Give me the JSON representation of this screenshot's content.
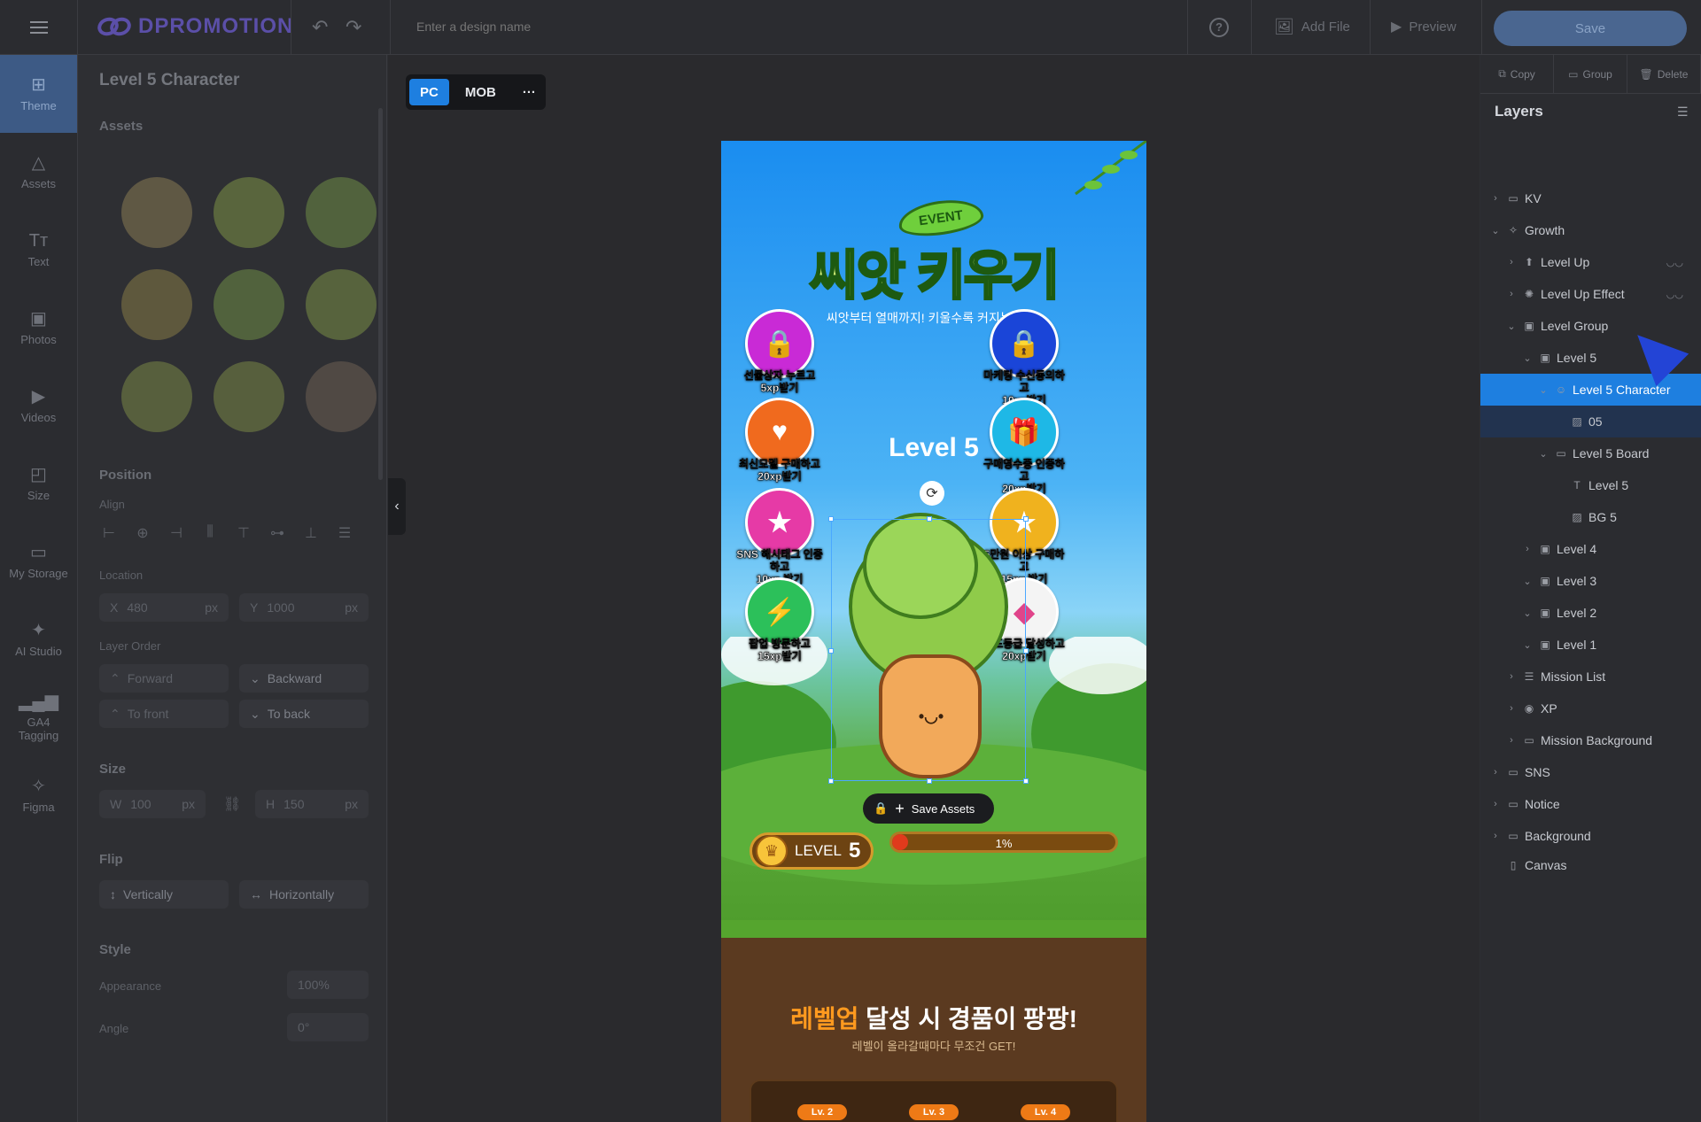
{
  "app": {
    "logo": "DPROMOTION",
    "design_name_placeholder": "Enter a design name",
    "help": "?",
    "add_file": "Add File",
    "preview": "Preview",
    "save": "Save"
  },
  "nav": [
    {
      "label": "Theme",
      "icon": "theme-icon",
      "glyph": "⊞"
    },
    {
      "label": "Assets",
      "icon": "shapes-icon",
      "glyph": "△"
    },
    {
      "label": "Text",
      "icon": "text-icon",
      "glyph": "Tт"
    },
    {
      "label": "Photos",
      "icon": "photo-icon",
      "glyph": "▣"
    },
    {
      "label": "Videos",
      "icon": "video-icon",
      "glyph": "▶"
    },
    {
      "label": "Size",
      "icon": "resize-icon",
      "glyph": "◰"
    },
    {
      "label": "My Storage",
      "icon": "folder-icon",
      "glyph": "▭"
    },
    {
      "label": "AI Studio",
      "icon": "magic-wand-icon",
      "glyph": "✦"
    },
    {
      "label": "GA4\nTagging",
      "icon": "analytics-icon",
      "glyph": "▂▄▆"
    },
    {
      "label": "Figma",
      "icon": "figma-icon",
      "glyph": "✧"
    }
  ],
  "left_panel": {
    "title": "Level 5 Character",
    "assets_label": "Assets",
    "position": "Position",
    "align": "Align",
    "location": "Location",
    "x_label": "X",
    "x_value": "480",
    "y_label": "Y",
    "y_value": "1000",
    "unit": "px",
    "layer_order": "Layer Order",
    "forward": "Forward",
    "backward": "Backward",
    "to_front": "To front",
    "to_back": "To back",
    "size": "Size",
    "w_label": "W",
    "w_value": "100",
    "h_label": "H",
    "h_value": "150",
    "flip": "Flip",
    "vertically": "Vertically",
    "horizontally": "Horizontally",
    "style": "Style",
    "appearance": "Appearance",
    "appearance_value": "100%",
    "angle": "Angle",
    "angle_value": "0°"
  },
  "canvas": {
    "pc": "PC",
    "mob": "MOB",
    "more": "···",
    "event": "EVENT",
    "headline": "씨앗 키우기",
    "subline": "씨앗부터 열매까지! 키울수록 커지는 혜택!",
    "level_title": "Level 5",
    "missions": [
      {
        "line1": "선물상자 누르고",
        "line2": "5xp받기",
        "color": "#c92ad6",
        "glyph": "🔒",
        "icon": "treasure-chest-icon"
      },
      {
        "line1": "마케팅 수신동의하고",
        "line2": "10xp받기",
        "color": "#1a45d8",
        "glyph": "🔒",
        "icon": "padlock-icon"
      },
      {
        "line1": "최신모델 구매하고",
        "line2": "20xp받기",
        "color": "#f06a1e",
        "glyph": "♥",
        "icon": "shopping-bag-icon"
      },
      {
        "line1": "구매영수증 인증하고",
        "line2": "20xp받기",
        "color": "#1eb8e6",
        "glyph": "🎁",
        "icon": "gift-box-icon"
      },
      {
        "line1": "SNS 해시태그 인증하고",
        "line2": "10xp 받기",
        "color": "#e63aa6",
        "glyph": "★",
        "icon": "book-icon"
      },
      {
        "line1": "5만원 이상 구매하고",
        "line2": "15px 받기",
        "color": "#f0b21e",
        "glyph": "★",
        "icon": "coin-star-icon"
      },
      {
        "line1": "팝업 방문하고",
        "line2": "15xp받기",
        "color": "#2cc05a",
        "glyph": "⚡",
        "icon": "lightning-icon"
      },
      {
        "line1": "골드등급 달성하고",
        "line2": "20xp받기",
        "color": "#f4f4f4",
        "glyph": "◆",
        "icon": "gem-icon"
      }
    ],
    "save_assets": "Save Assets",
    "level_label": "LEVEL",
    "level_number": "5",
    "progress_text": "1%",
    "progress_value": 0.01,
    "reward_highlight": "레벨업",
    "reward_rest": " 달성 시 경품이 팡팡!",
    "reward_sub": "레벨이 올라갈때마다 무조건 GET!",
    "level_tags": [
      "Lv. 2",
      "Lv. 3",
      "Lv. 4"
    ]
  },
  "right_panel": {
    "copy": "Copy",
    "group": "Group",
    "delete": "Delete",
    "layers_title": "Layers",
    "layers": [
      {
        "label": "KV",
        "indent": 0,
        "chev": "›",
        "icon": "folder-icon",
        "glyph": "▭"
      },
      {
        "label": "Growth",
        "indent": 0,
        "chev": "⌄",
        "icon": "sparkle-icon",
        "glyph": "✧"
      },
      {
        "label": "Level Up",
        "indent": 1,
        "chev": "›",
        "icon": "arrow-up-icon",
        "glyph": "⬆",
        "hidden": true
      },
      {
        "label": "Level Up Effect",
        "indent": 1,
        "chev": "›",
        "icon": "effect-icon",
        "glyph": "✺",
        "hidden": true
      },
      {
        "label": "Level Group",
        "indent": 1,
        "chev": "⌄",
        "icon": "frame-icon",
        "glyph": "▣"
      },
      {
        "label": "Level 5",
        "indent": 2,
        "chev": "⌄",
        "icon": "frame-icon",
        "glyph": "▣"
      },
      {
        "label": "Level 5 Character",
        "indent": 3,
        "chev": "⌄",
        "icon": "character-icon",
        "glyph": "☺",
        "selected": true
      },
      {
        "label": "05",
        "indent": 4,
        "chev": "",
        "icon": "image-icon",
        "glyph": "▨",
        "sub": true
      },
      {
        "label": "Level 5 Board",
        "indent": 3,
        "chev": "⌄",
        "icon": "board-icon",
        "glyph": "▭"
      },
      {
        "label": "Level 5",
        "indent": 4,
        "chev": "",
        "icon": "text-icon",
        "glyph": "T"
      },
      {
        "label": "BG 5",
        "indent": 4,
        "chev": "",
        "icon": "image-icon",
        "glyph": "▨"
      },
      {
        "label": "Level 4",
        "indent": 2,
        "chev": "›",
        "icon": "frame-icon",
        "glyph": "▣"
      },
      {
        "label": "Level 3",
        "indent": 2,
        "chev": "⌄",
        "icon": "frame-icon",
        "glyph": "▣"
      },
      {
        "label": "Level 2",
        "indent": 2,
        "chev": "⌄",
        "icon": "frame-icon",
        "glyph": "▣"
      },
      {
        "label": "Level 1",
        "indent": 2,
        "chev": "⌄",
        "icon": "frame-icon",
        "glyph": "▣"
      },
      {
        "label": "Mission List",
        "indent": 1,
        "chev": "›",
        "icon": "list-icon",
        "glyph": "☰"
      },
      {
        "label": "XP",
        "indent": 1,
        "chev": "›",
        "icon": "xp-icon",
        "glyph": "◉"
      },
      {
        "label": "Mission Background",
        "indent": 1,
        "chev": "›",
        "icon": "folder-icon",
        "glyph": "▭"
      },
      {
        "label": "SNS",
        "indent": 0,
        "chev": "›",
        "icon": "folder-icon",
        "glyph": "▭"
      },
      {
        "label": "Notice",
        "indent": 0,
        "chev": "›",
        "icon": "folder-icon",
        "glyph": "▭"
      },
      {
        "label": "Background",
        "indent": 0,
        "chev": "›",
        "icon": "folder-icon",
        "glyph": "▭"
      },
      {
        "label": "Canvas",
        "indent": 0,
        "chev": "",
        "icon": "canvas-icon",
        "glyph": "▯"
      }
    ]
  }
}
